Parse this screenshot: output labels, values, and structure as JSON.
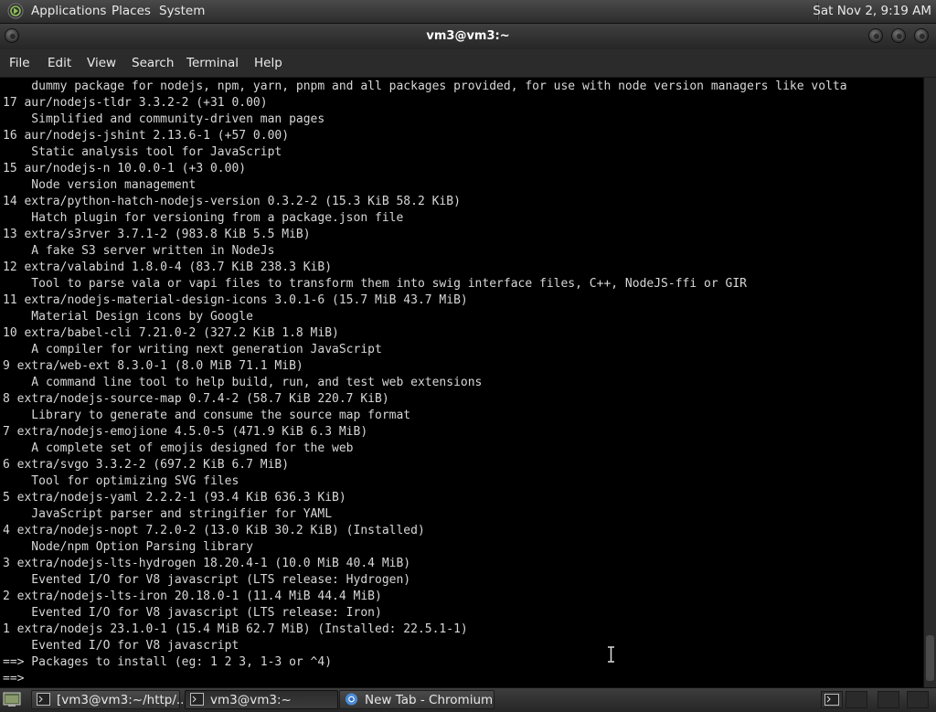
{
  "top_panel": {
    "menus": [
      "Applications",
      "Places",
      "System"
    ],
    "clock": "Sat Nov 2, 9:19 AM"
  },
  "window": {
    "title": "vm3@vm3:~"
  },
  "menubar": {
    "items": [
      "File",
      "Edit",
      "View",
      "Search",
      "Terminal",
      "Help"
    ]
  },
  "terminal": {
    "lines": [
      "    dummy package for nodejs, npm, yarn, pnpm and all packages provided, for use with node version managers like volta",
      "17 aur/nodejs-tldr 3.3.2-2 (+31 0.00)",
      "    Simplified and community-driven man pages",
      "16 aur/nodejs-jshint 2.13.6-1 (+57 0.00)",
      "    Static analysis tool for JavaScript",
      "15 aur/nodejs-n 10.0.0-1 (+3 0.00)",
      "    Node version management",
      "14 extra/python-hatch-nodejs-version 0.3.2-2 (15.3 KiB 58.2 KiB)",
      "    Hatch plugin for versioning from a package.json file",
      "13 extra/s3rver 3.7.1-2 (983.8 KiB 5.5 MiB)",
      "    A fake S3 server written in NodeJs",
      "12 extra/valabind 1.8.0-4 (83.7 KiB 238.3 KiB)",
      "    Tool to parse vala or vapi files to transform them into swig interface files, C++, NodeJS-ffi or GIR",
      "11 extra/nodejs-material-design-icons 3.0.1-6 (15.7 MiB 43.7 MiB)",
      "    Material Design icons by Google",
      "10 extra/babel-cli 7.21.0-2 (327.2 KiB 1.8 MiB)",
      "    A compiler for writing next generation JavaScript",
      "9 extra/web-ext 8.3.0-1 (8.0 MiB 71.1 MiB)",
      "    A command line tool to help build, run, and test web extensions",
      "8 extra/nodejs-source-map 0.7.4-2 (58.7 KiB 220.7 KiB)",
      "    Library to generate and consume the source map format",
      "7 extra/nodejs-emojione 4.5.0-5 (471.9 KiB 6.3 MiB)",
      "    A complete set of emojis designed for the web",
      "6 extra/svgo 3.3.2-2 (697.2 KiB 6.7 MiB)",
      "    Tool for optimizing SVG files",
      "5 extra/nodejs-yaml 2.2.2-1 (93.4 KiB 636.3 KiB)",
      "    JavaScript parser and stringifier for YAML",
      "4 extra/nodejs-nopt 7.2.0-2 (13.0 KiB 30.2 KiB) (Installed)",
      "    Node/npm Option Parsing library",
      "3 extra/nodejs-lts-hydrogen 18.20.4-1 (10.0 MiB 40.4 MiB)",
      "    Evented I/O for V8 javascript (LTS release: Hydrogen)",
      "2 extra/nodejs-lts-iron 20.18.0-1 (11.4 MiB 44.4 MiB)",
      "    Evented I/O for V8 javascript (LTS release: Iron)",
      "1 extra/nodejs 23.1.0-1 (15.4 MiB 62.7 MiB) (Installed: 22.5.1-1)",
      "    Evented I/O for V8 javascript",
      "==> Packages to install (eg: 1 2 3, 1-3 or ^4)",
      "==> "
    ]
  },
  "taskbar": {
    "tasks": [
      {
        "label": "[vm3@vm3:~/http/...",
        "icon": "terminal-icon"
      },
      {
        "label": "vm3@vm3:~",
        "icon": "terminal-icon"
      },
      {
        "label": "New Tab - Chromium",
        "icon": "chromium-icon"
      }
    ]
  }
}
